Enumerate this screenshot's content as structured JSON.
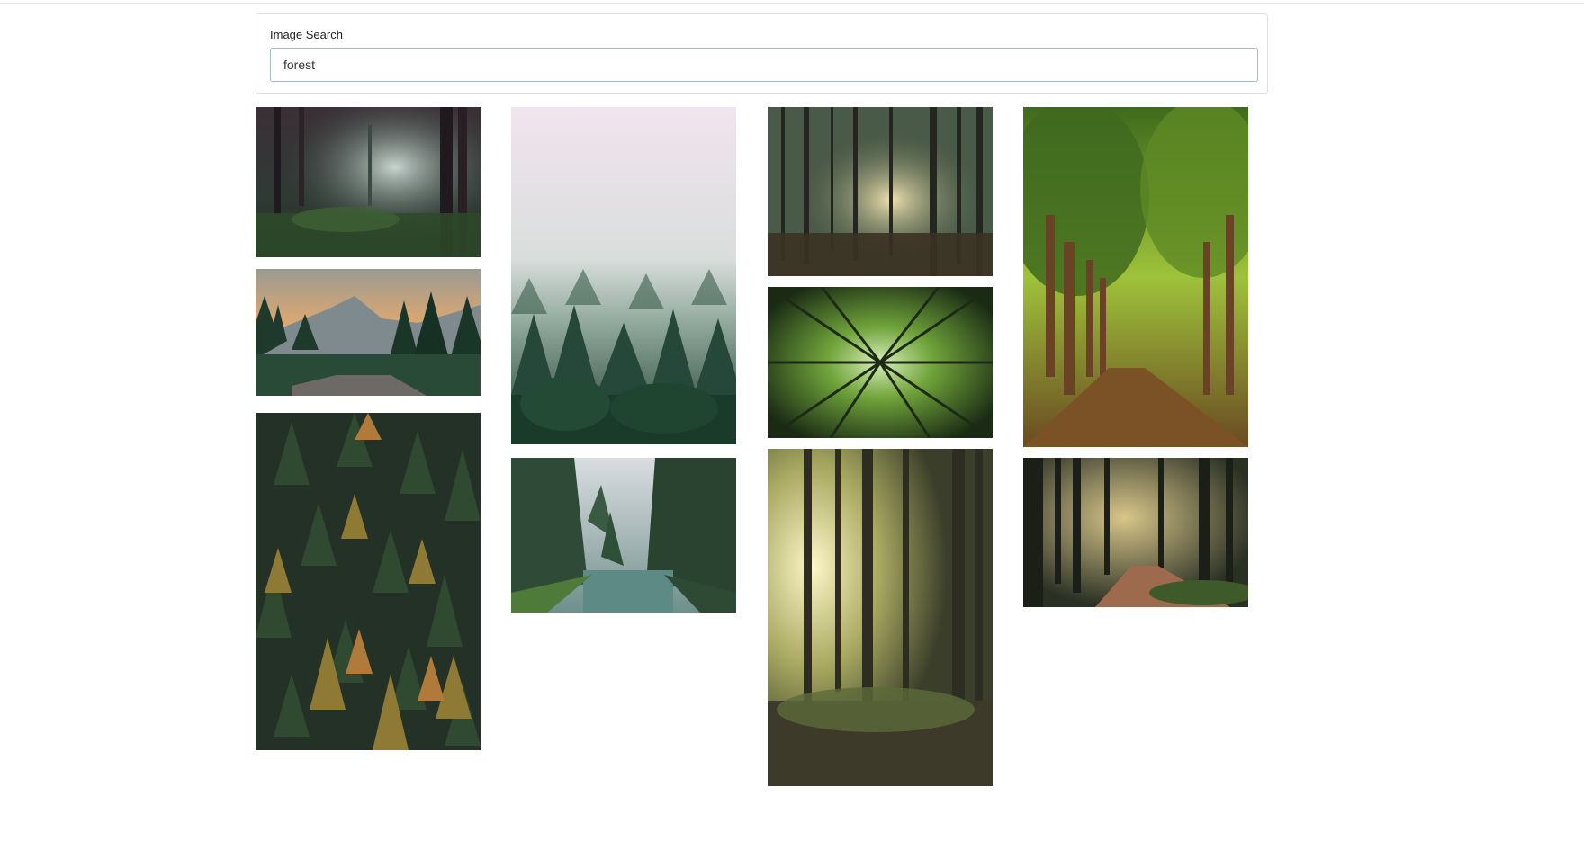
{
  "search": {
    "label": "Image Search",
    "query": "forest"
  },
  "results": [
    {
      "id": "misty-dark-forest"
    },
    {
      "id": "mountain-sunset-pines"
    },
    {
      "id": "aerial-autumn-conifers"
    },
    {
      "id": "foggy-pine-forest"
    },
    {
      "id": "forest-river"
    },
    {
      "id": "sunlit-pine-trunks"
    },
    {
      "id": "looking-up-canopy"
    },
    {
      "id": "sunbeams-through-trees"
    },
    {
      "id": "green-tree-avenue"
    },
    {
      "id": "forest-path"
    }
  ]
}
